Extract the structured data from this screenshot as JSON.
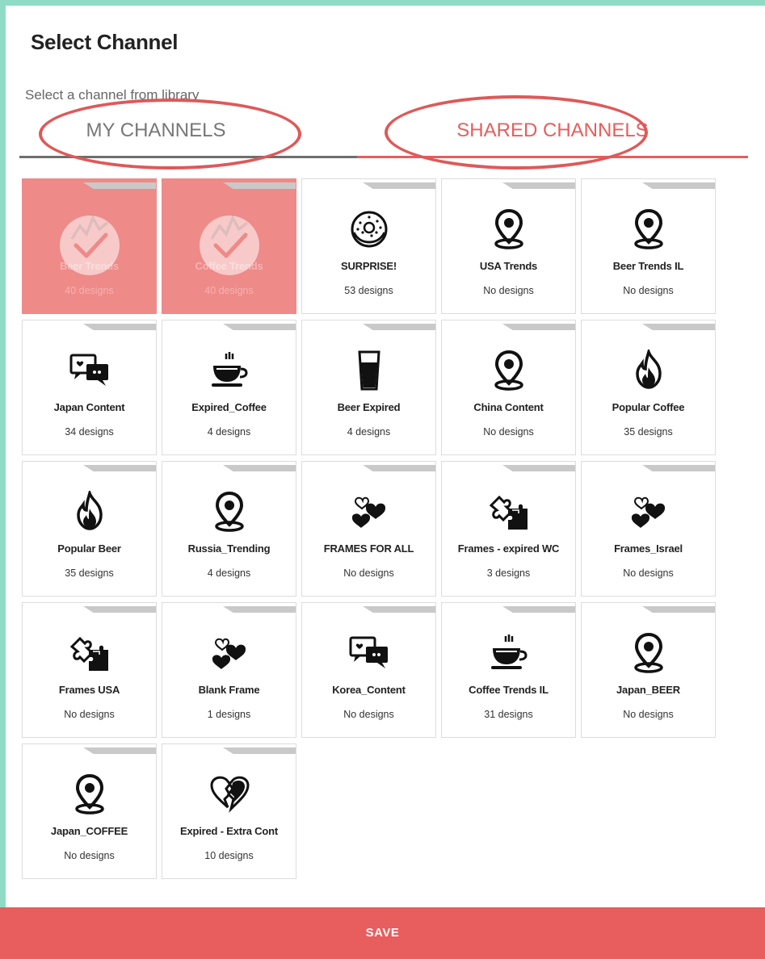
{
  "dialog": {
    "title": "Select Channel",
    "subtitle": "Select a channel from library"
  },
  "tabs": [
    {
      "label": "MY CHANNELS",
      "active": false
    },
    {
      "label": "SHARED CHANNELS",
      "active": true
    }
  ],
  "colors": {
    "accent": "#e85d5d",
    "selected_card": "#ee8a88",
    "background": "#8fdbc6"
  },
  "channels": [
    {
      "name": "Beer Trends",
      "count": "40 designs",
      "icon": "trend-icon",
      "selected": true
    },
    {
      "name": "Coffee Trends",
      "count": "40 designs",
      "icon": "trend-icon",
      "selected": true
    },
    {
      "name": "SURPRISE!",
      "count": "53 designs",
      "icon": "donut-icon",
      "selected": false
    },
    {
      "name": "USA Trends",
      "count": "No designs",
      "icon": "location-pin-icon",
      "selected": false
    },
    {
      "name": "Beer Trends IL",
      "count": "No designs",
      "icon": "location-pin-icon",
      "selected": false
    },
    {
      "name": "Japan Content",
      "count": "34 designs",
      "icon": "chat-bubbles-icon",
      "selected": false
    },
    {
      "name": "Expired_Coffee",
      "count": "4 designs",
      "icon": "coffee-cup-icon",
      "selected": false
    },
    {
      "name": "Beer Expired",
      "count": "4 designs",
      "icon": "beer-glass-icon",
      "selected": false
    },
    {
      "name": "China Content",
      "count": "No designs",
      "icon": "location-pin-icon",
      "selected": false
    },
    {
      "name": "Popular Coffee",
      "count": "35 designs",
      "icon": "flame-icon",
      "selected": false
    },
    {
      "name": "Popular Beer",
      "count": "35 designs",
      "icon": "flame-icon",
      "selected": false
    },
    {
      "name": "Russia_Trending",
      "count": "4 designs",
      "icon": "location-pin-icon",
      "selected": false
    },
    {
      "name": "FRAMES FOR ALL",
      "count": "No designs",
      "icon": "hearts-icon",
      "selected": false
    },
    {
      "name": "Frames - expired WC",
      "count": "3 designs",
      "icon": "puzzle-icon",
      "selected": false
    },
    {
      "name": "Frames_Israel",
      "count": "No designs",
      "icon": "hearts-icon",
      "selected": false
    },
    {
      "name": "Frames USA",
      "count": "No designs",
      "icon": "puzzle-icon",
      "selected": false
    },
    {
      "name": "Blank Frame",
      "count": "1 designs",
      "icon": "hearts-icon",
      "selected": false
    },
    {
      "name": "Korea_Content",
      "count": "No designs",
      "icon": "chat-bubbles-icon",
      "selected": false
    },
    {
      "name": "Coffee Trends IL",
      "count": "31 designs",
      "icon": "coffee-cup-icon",
      "selected": false
    },
    {
      "name": "Japan_BEER",
      "count": "No designs",
      "icon": "location-pin-icon",
      "selected": false
    },
    {
      "name": "Japan_COFFEE",
      "count": "No designs",
      "icon": "location-pin-icon",
      "selected": false
    },
    {
      "name": "Expired - Extra Cont",
      "count": "10 designs",
      "icon": "broken-heart-icon",
      "selected": false
    }
  ],
  "footer": {
    "save_label": "SAVE"
  }
}
